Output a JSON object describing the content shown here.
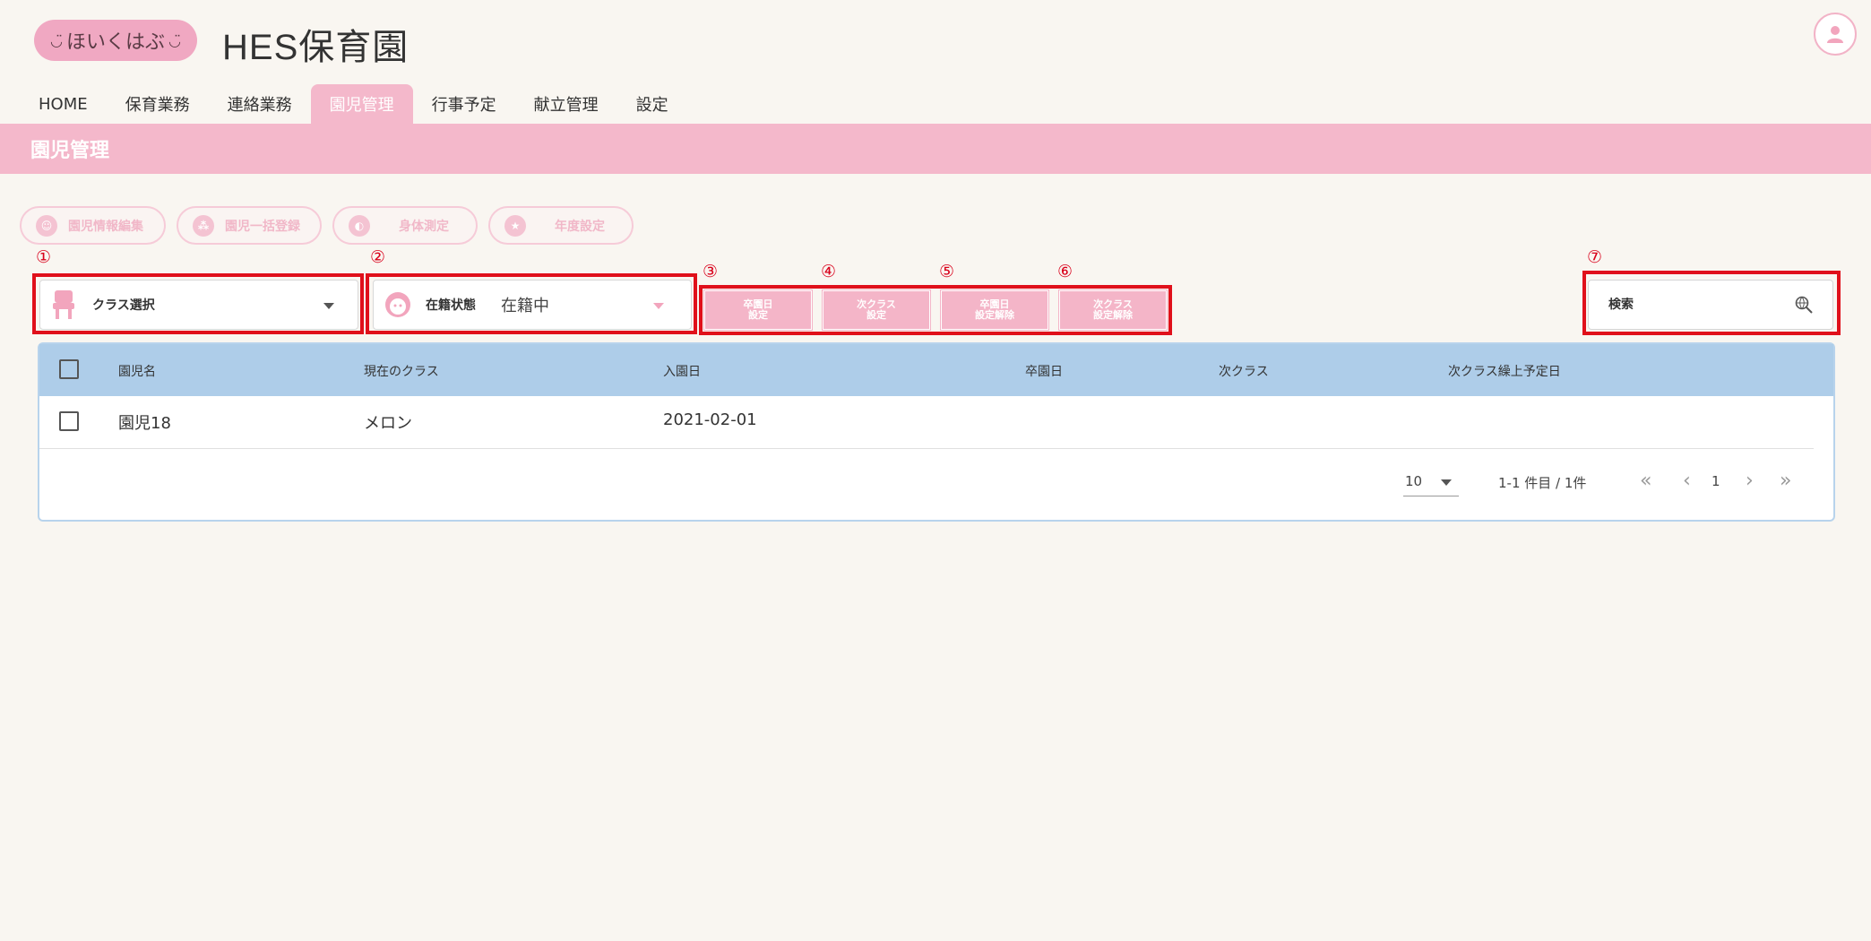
{
  "header": {
    "logo_text": "ほいくはぶ",
    "app_title": "HES保育園"
  },
  "nav": {
    "tabs": [
      "HOME",
      "保育業務",
      "連絡業務",
      "園児管理",
      "行事予定",
      "献立管理",
      "設定"
    ],
    "active_index": 3
  },
  "page": {
    "title": "園児管理"
  },
  "function_buttons": [
    "園児情報編集",
    "園児一括登録",
    "身体測定",
    "年度設定"
  ],
  "markers": [
    "①",
    "②",
    "③",
    "④",
    "⑤",
    "⑥",
    "⑦"
  ],
  "filters": {
    "class_select_label": "クラス選択",
    "status_label": "在籍状態",
    "status_value": "在籍中"
  },
  "action_buttons": [
    "卒園日\n設定",
    "次クラス\n設定",
    "卒園日\n設定解除",
    "次クラス\n設定解除"
  ],
  "search": {
    "placeholder": "検索"
  },
  "table": {
    "columns": [
      "園児名",
      "現在のクラス",
      "入園日",
      "卒園日",
      "次クラス",
      "次クラス繰上予定日"
    ],
    "rows": [
      {
        "name": "園児18",
        "current_class": "メロン",
        "enrollment_date": "2021-02-01",
        "graduation_date": "",
        "next_class": "",
        "next_class_date": ""
      }
    ]
  },
  "pagination": {
    "per_page": "10",
    "range_text": "1-1 件目 / 1件",
    "current_page": "1"
  },
  "colors": {
    "accent_pink": "#f4b8cb",
    "table_header": "#aecde9",
    "highlight_red": "#e0101b",
    "background": "#f9f6f1"
  }
}
